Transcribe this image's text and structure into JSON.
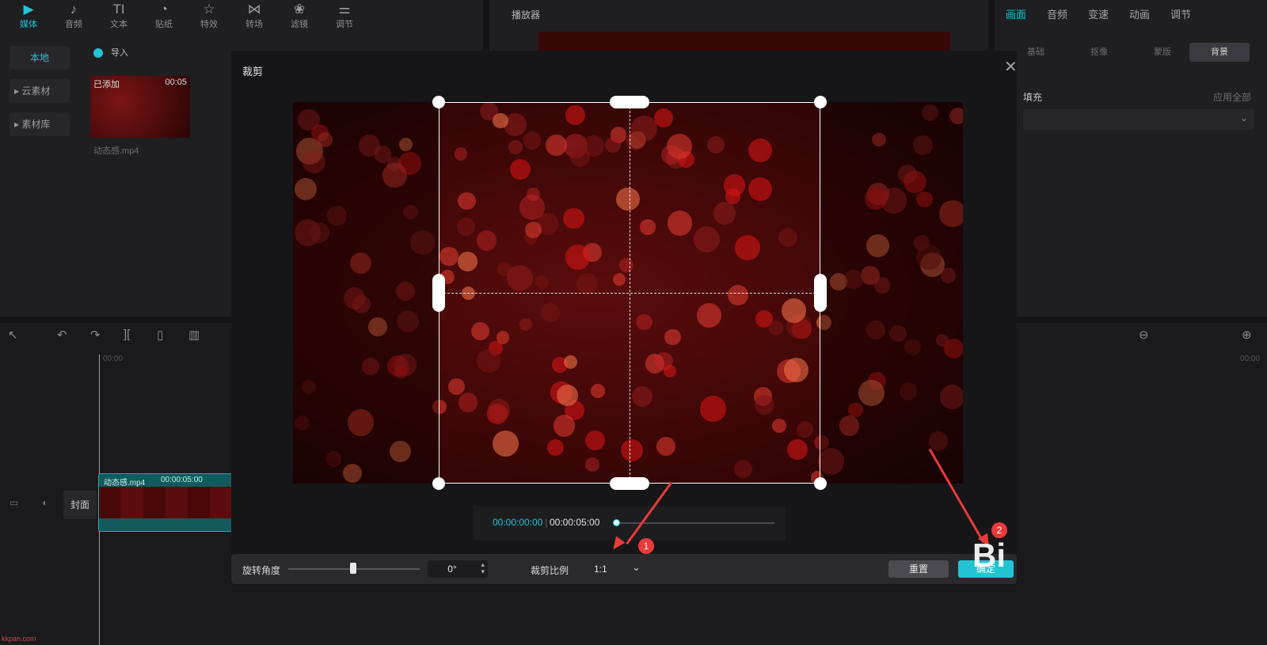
{
  "toolbar": {
    "tabs": [
      {
        "label": "媒体",
        "icon": "media-icon",
        "glyph": "▶"
      },
      {
        "label": "音频",
        "icon": "audio-icon",
        "glyph": "♪"
      },
      {
        "label": "文本",
        "icon": "text-icon",
        "glyph": "TI"
      },
      {
        "label": "贴纸",
        "icon": "sticker-icon",
        "glyph": "◔"
      },
      {
        "label": "特效",
        "icon": "effects-icon",
        "glyph": "☆"
      },
      {
        "label": "转场",
        "icon": "transition-icon",
        "glyph": "⋈"
      },
      {
        "label": "滤镜",
        "icon": "filter-icon",
        "glyph": "❀"
      },
      {
        "label": "调节",
        "icon": "adjust-icon",
        "glyph": "⚌"
      }
    ]
  },
  "media_panel": {
    "side_items": [
      "本地",
      "云素材",
      "素材库"
    ],
    "import_label": "导入",
    "clip": {
      "badge": "已添加",
      "duration": "00:05",
      "filename": "动态感.mp4"
    }
  },
  "player": {
    "title": "播放器"
  },
  "inspector": {
    "tabs": [
      "画面",
      "音频",
      "变速",
      "动画",
      "调节"
    ],
    "subtabs": [
      "基础",
      "抠像",
      "蒙版",
      "背景"
    ],
    "fill_label": "填充",
    "apply_all_label": "应用全部"
  },
  "timeline": {
    "start_time": "00:00",
    "track_clip_name": "动态感.mp4",
    "track_clip_duration": "00:00:05:00",
    "cover_label": "封面",
    "ruler_right": "00:00"
  },
  "crop_dialog": {
    "title": "裁剪",
    "current_time": "00:00:00:00",
    "total_time": "00:00:05:00",
    "rotation_label": "旋转角度",
    "rotation_value": "0°",
    "ratio_label": "裁剪比例",
    "ratio_value": "1:1",
    "reset_label": "重置",
    "confirm_label": "确定"
  },
  "annotations": {
    "step1": "1",
    "step2": "2",
    "watermark": "Bi",
    "site_text": "kkpan.com"
  },
  "colors": {
    "accent": "#22c4d4",
    "annotation_red": "#e83a3a",
    "crop_border": "#ffffff"
  }
}
